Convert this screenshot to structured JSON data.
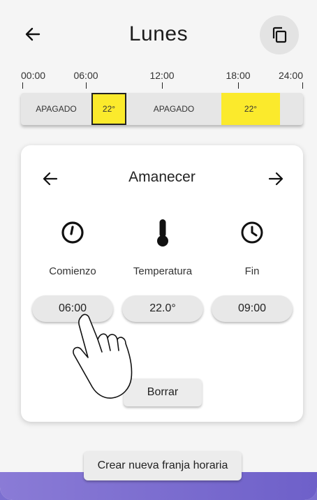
{
  "header": {
    "title": "Lunes",
    "back_icon": "arrow-left-icon",
    "copy_icon": "copy-icon"
  },
  "timeline": {
    "ticks": [
      "00:00",
      "06:00",
      "12:00",
      "18:00",
      "24:00"
    ]
  },
  "schedule": {
    "segments": [
      {
        "label": "APAGADO",
        "state": "off"
      },
      {
        "label": "22°",
        "state": "on",
        "selected": true
      },
      {
        "label": "APAGADO",
        "state": "off"
      },
      {
        "label": "22°",
        "state": "on"
      },
      {
        "label": "",
        "state": "off"
      }
    ],
    "on_color": "#fbea2c"
  },
  "card": {
    "title": "Amanecer",
    "prev_icon": "arrow-left-icon",
    "next_icon": "arrow-right-icon",
    "start": {
      "icon": "clock-start-icon",
      "label": "Comienzo",
      "value": "06:00"
    },
    "temperature": {
      "icon": "thermometer-icon",
      "label": "Temperatura",
      "value": "22.0°"
    },
    "end": {
      "icon": "clock-icon",
      "label": "Fin",
      "value": "09:00"
    },
    "delete_label": "Borrar"
  },
  "footer": {
    "new_slot_label": "Crear nueva franja horaria"
  }
}
